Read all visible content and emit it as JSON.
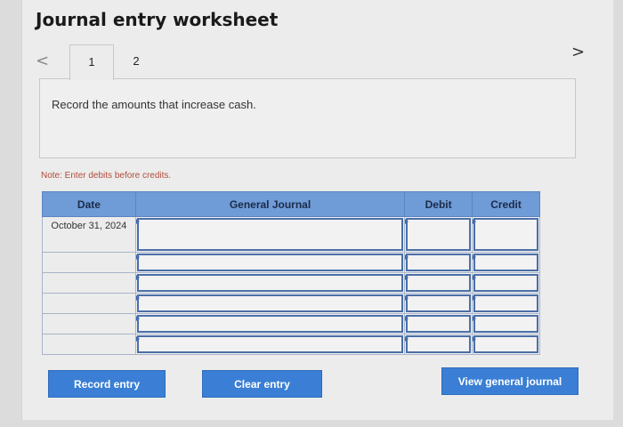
{
  "page": {
    "title": "Journal entry worksheet",
    "nav_prev": "<",
    "nav_next": ">",
    "tabs": [
      {
        "label": "1",
        "active": true
      },
      {
        "label": "2",
        "active": false
      }
    ],
    "instruction": "Record the amounts that increase cash.",
    "note": "Note: Enter debits before credits."
  },
  "table": {
    "headers": [
      "Date",
      "General Journal",
      "Debit",
      "Credit"
    ],
    "rows": [
      {
        "date": "October 31, 2024",
        "general_journal": "",
        "debit": "",
        "credit": ""
      },
      {
        "date": "",
        "general_journal": "",
        "debit": "",
        "credit": ""
      },
      {
        "date": "",
        "general_journal": "",
        "debit": "",
        "credit": ""
      },
      {
        "date": "",
        "general_journal": "",
        "debit": "",
        "credit": ""
      },
      {
        "date": "",
        "general_journal": "",
        "debit": "",
        "credit": ""
      },
      {
        "date": "",
        "general_journal": "",
        "debit": "",
        "credit": ""
      }
    ]
  },
  "buttons": {
    "record_entry": "Record entry",
    "clear_entry": "Clear entry",
    "view_general_journal": "View general journal"
  },
  "colors": {
    "header_bg": "#6f9bd6",
    "button_bg": "#3a7fd5",
    "note_text": "#b34b3b"
  }
}
